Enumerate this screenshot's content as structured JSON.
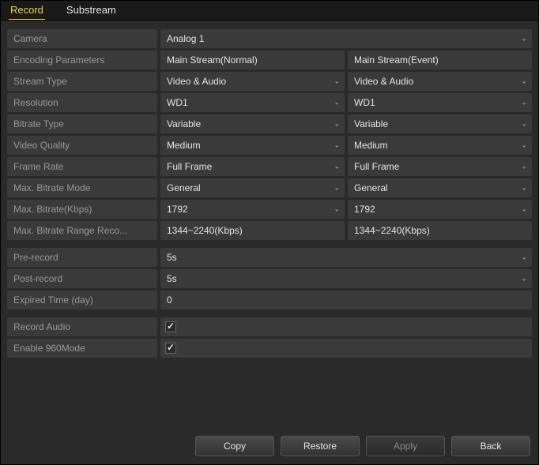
{
  "tabs": {
    "record": "Record",
    "substream": "Substream"
  },
  "labels": {
    "camera": "Camera",
    "encoding": "Encoding Parameters",
    "stream_type": "Stream Type",
    "resolution": "Resolution",
    "bitrate_type": "Bitrate Type",
    "video_quality": "Video Quality",
    "frame_rate": "Frame Rate",
    "max_bitrate_mode": "Max. Bitrate Mode",
    "max_bitrate_kbps": "Max. Bitrate(Kbps)",
    "max_bitrate_range": "Max. Bitrate Range Reco...",
    "pre_record": "Pre-record",
    "post_record": "Post-record",
    "expired_time": "Expired Time (day)",
    "record_audio": "Record Audio",
    "enable_960": "Enable 960Mode"
  },
  "values": {
    "camera": "Analog 1",
    "normal": {
      "encoding": "Main Stream(Normal)",
      "stream_type": "Video & Audio",
      "resolution": "WD1",
      "bitrate_type": "Variable",
      "video_quality": "Medium",
      "frame_rate": "Full Frame",
      "max_bitrate_mode": "General",
      "max_bitrate_kbps": "1792",
      "max_bitrate_range": "1344~2240(Kbps)"
    },
    "event": {
      "encoding": "Main Stream(Event)",
      "stream_type": "Video & Audio",
      "resolution": "WD1",
      "bitrate_type": "Variable",
      "video_quality": "Medium",
      "frame_rate": "Full Frame",
      "max_bitrate_mode": "General",
      "max_bitrate_kbps": "1792",
      "max_bitrate_range": "1344~2240(Kbps)"
    },
    "pre_record": "5s",
    "post_record": "5s",
    "expired_time": "0",
    "record_audio": true,
    "enable_960": true
  },
  "buttons": {
    "copy": "Copy",
    "restore": "Restore",
    "apply": "Apply",
    "back": "Back"
  }
}
